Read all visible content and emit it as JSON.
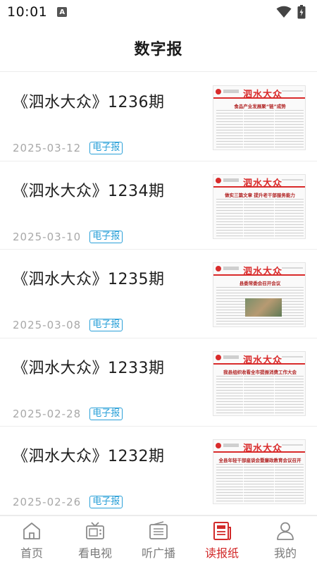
{
  "status_bar": {
    "time": "10:01",
    "notification_letter": "A"
  },
  "header": {
    "title": "数字报"
  },
  "list": {
    "items": [
      {
        "title": "《泗水大众》1236期",
        "date": "2025-03-12",
        "badge": "电子报",
        "thumb_masthead": "泗水大众",
        "thumb_headline": "食品产业发展聚“链”成势"
      },
      {
        "title": "《泗水大众》1234期",
        "date": "2025-03-10",
        "badge": "电子报",
        "thumb_masthead": "泗水大众",
        "thumb_headline": "做实三篇文章 提升老干部服务能力"
      },
      {
        "title": "《泗水大众》1235期",
        "date": "2025-03-08",
        "badge": "电子报",
        "thumb_masthead": "泗水大众",
        "thumb_headline": "县委常委会召开会议"
      },
      {
        "title": "《泗水大众》1233期",
        "date": "2025-02-28",
        "badge": "电子报",
        "thumb_masthead": "泗水大众",
        "thumb_headline": "我县组织收看全市提振消费工作大会"
      },
      {
        "title": "《泗水大众》1232期",
        "date": "2025-02-26",
        "badge": "电子报",
        "thumb_masthead": "泗水大众",
        "thumb_headline": "全县年轻干部座谈会暨廉政教育会议召开"
      }
    ]
  },
  "tabbar": {
    "active_color": "#d22a2a",
    "inactive_color": "#7a7a7a",
    "tabs": [
      {
        "label": "首页",
        "icon": "home-icon"
      },
      {
        "label": "看电视",
        "icon": "tv-icon"
      },
      {
        "label": "听广播",
        "icon": "radio-icon"
      },
      {
        "label": "读报纸",
        "icon": "newspaper-icon",
        "active": true
      },
      {
        "label": "我的",
        "icon": "user-icon"
      }
    ]
  }
}
